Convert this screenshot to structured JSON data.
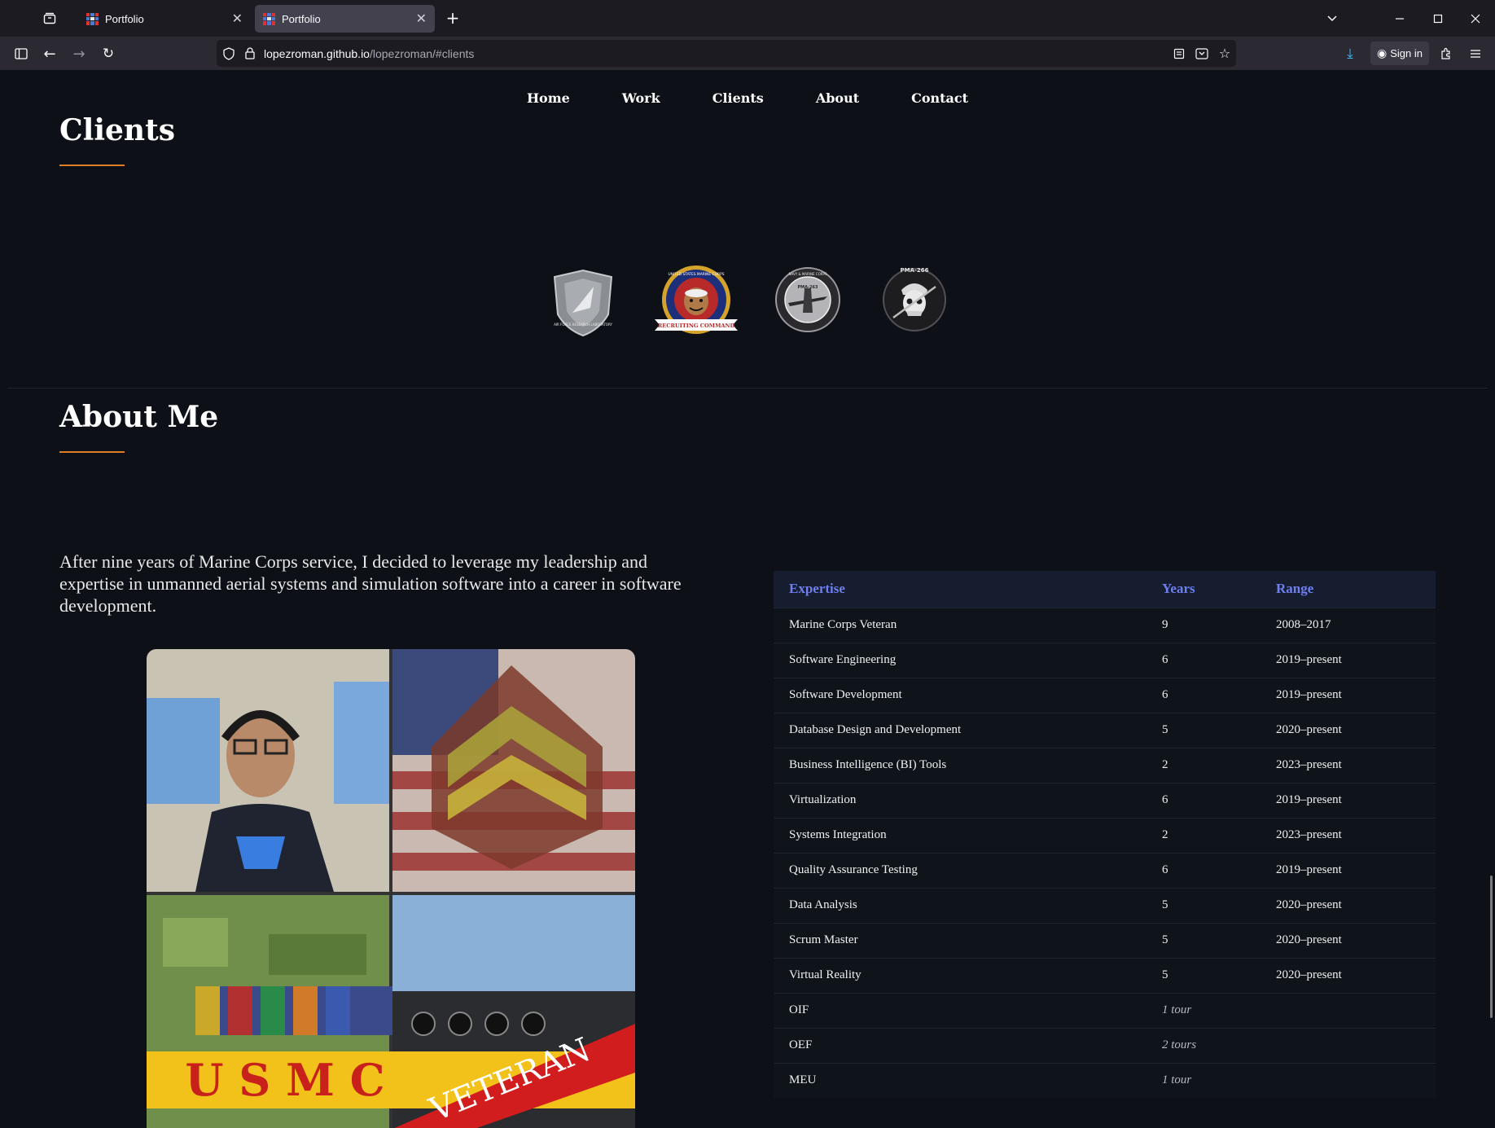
{
  "browser": {
    "tabs": [
      {
        "title": "Portfolio",
        "active": false
      },
      {
        "title": "Portfolio",
        "active": true
      }
    ],
    "url_host": "lopezroman.github.io",
    "url_path": "/lopezroman/#clients",
    "sign_in_label": "Sign in"
  },
  "site_nav": {
    "items": [
      "Home",
      "Work",
      "Clients",
      "About",
      "Contact"
    ]
  },
  "clients": {
    "title": "Clients",
    "logos": [
      {
        "icon": "air-force-research-lab-icon",
        "text": "AIR FORCE RESEARCH LABORATORY"
      },
      {
        "icon": "usmc-recruiting-command-icon",
        "text": "RECRUITING COMMAND",
        "arc_text": "UNITED STATES MARINE CORPS"
      },
      {
        "icon": "pma-263-icon",
        "text": "PMA-263",
        "arc_text": "NAVY & MARINE CORPS"
      },
      {
        "icon": "pma-266-icon",
        "text": "PMA-266"
      }
    ]
  },
  "about": {
    "title": "About Me",
    "paragraph": "After nine years of Marine Corps service, I decided to leverage my leadership and expertise in unmanned aerial systems and simulation software into a career in software development.",
    "photo": {
      "banner_text": "U S M C",
      "ribbon_text": "VETERAN"
    },
    "table": {
      "headers": [
        "Expertise",
        "Years",
        "Range"
      ],
      "rows": [
        {
          "expertise": "Marine Corps Veteran",
          "years": "9",
          "range": "2008–2017"
        },
        {
          "expertise": "Software Engineering",
          "years": "6",
          "range": "2019–present"
        },
        {
          "expertise": "Software Development",
          "years": "6",
          "range": "2019–present"
        },
        {
          "expertise": "Database Design and Development",
          "years": "5",
          "range": "2020–present"
        },
        {
          "expertise": "Business Intelligence (BI) Tools",
          "years": "2",
          "range": "2023–present"
        },
        {
          "expertise": "Virtualization",
          "years": "6",
          "range": "2019–present"
        },
        {
          "expertise": "Systems Integration",
          "years": "2",
          "range": "2023–present"
        },
        {
          "expertise": "Quality Assurance Testing",
          "years": "6",
          "range": "2019–present"
        },
        {
          "expertise": "Data Analysis",
          "years": "5",
          "range": "2020–present"
        },
        {
          "expertise": "Scrum Master",
          "years": "5",
          "range": "2020–present"
        },
        {
          "expertise": "Virtual Reality",
          "years": "5",
          "range": "2020–present"
        },
        {
          "expertise": "OIF",
          "years": "1 tour",
          "range": "",
          "italic": true
        },
        {
          "expertise": "OEF",
          "years": "2 tours",
          "range": "",
          "italic": true
        },
        {
          "expertise": "MEU",
          "years": "1 tour",
          "range": "",
          "italic": true
        }
      ]
    }
  },
  "colors": {
    "page_bg": "#0d1117",
    "accent_underline": "#e07b2a",
    "table_header_text": "#6f7ff0"
  }
}
